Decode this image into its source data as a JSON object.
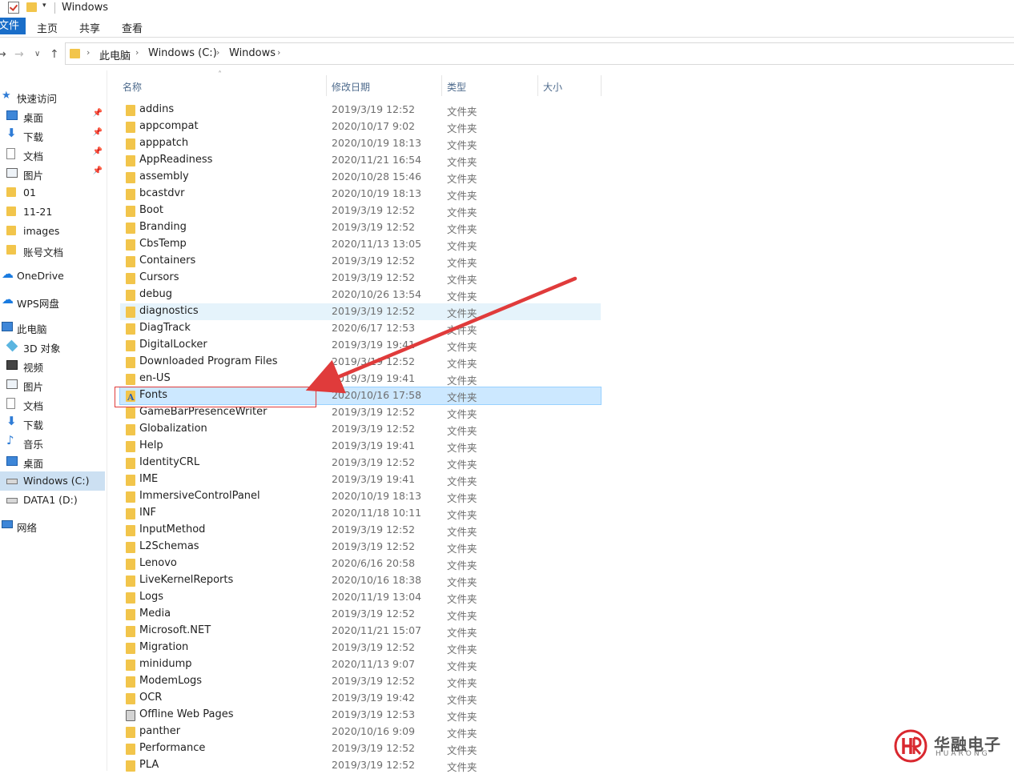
{
  "window": {
    "title": "Windows"
  },
  "ribbon": {
    "tabs": [
      "文件",
      "主页",
      "共享",
      "查看"
    ]
  },
  "address": {
    "crumbs": [
      "此电脑",
      "Windows (C:)",
      "Windows"
    ]
  },
  "columns": {
    "name": "名称",
    "date": "修改日期",
    "type": "类型",
    "size": "大小"
  },
  "sidebar": [
    {
      "label": "快速访问",
      "icon": "star-icon",
      "group": true
    },
    {
      "label": "桌面",
      "icon": "desktop-icon",
      "pinned": true
    },
    {
      "label": "下载",
      "icon": "download-icon",
      "pinned": true
    },
    {
      "label": "文档",
      "icon": "document-icon",
      "pinned": true
    },
    {
      "label": "图片",
      "icon": "picture-icon",
      "pinned": true
    },
    {
      "label": "01",
      "icon": "folder-icon"
    },
    {
      "label": "11-21",
      "icon": "folder-icon"
    },
    {
      "label": "images",
      "icon": "folder-icon"
    },
    {
      "label": "账号文档",
      "icon": "folder-icon"
    },
    {
      "label": "OneDrive",
      "icon": "cloud-icon",
      "group": true
    },
    {
      "label": "WPS网盘",
      "icon": "cloud-icon",
      "group": true
    },
    {
      "label": "此电脑",
      "icon": "pc-icon",
      "group": true
    },
    {
      "label": "3D 对象",
      "icon": "3d-objects-icon"
    },
    {
      "label": "视频",
      "icon": "video-icon"
    },
    {
      "label": "图片",
      "icon": "picture-icon"
    },
    {
      "label": "文档",
      "icon": "document-icon"
    },
    {
      "label": "下载",
      "icon": "download-icon"
    },
    {
      "label": "音乐",
      "icon": "music-icon"
    },
    {
      "label": "桌面",
      "icon": "desktop-icon"
    },
    {
      "label": "Windows (C:)",
      "icon": "drive-icon",
      "selected": true
    },
    {
      "label": "DATA1 (D:)",
      "icon": "drive-icon"
    },
    {
      "label": "网络",
      "icon": "network-icon",
      "group": true
    }
  ],
  "files": [
    {
      "name": "addins",
      "date": "2019/3/19 12:52",
      "type": "文件夹"
    },
    {
      "name": "appcompat",
      "date": "2020/10/17 9:02",
      "type": "文件夹"
    },
    {
      "name": "apppatch",
      "date": "2020/10/19 18:13",
      "type": "文件夹"
    },
    {
      "name": "AppReadiness",
      "date": "2020/11/21 16:54",
      "type": "文件夹"
    },
    {
      "name": "assembly",
      "date": "2020/10/28 15:46",
      "type": "文件夹"
    },
    {
      "name": "bcastdvr",
      "date": "2020/10/19 18:13",
      "type": "文件夹"
    },
    {
      "name": "Boot",
      "date": "2019/3/19 12:52",
      "type": "文件夹"
    },
    {
      "name": "Branding",
      "date": "2019/3/19 12:52",
      "type": "文件夹"
    },
    {
      "name": "CbsTemp",
      "date": "2020/11/13 13:05",
      "type": "文件夹"
    },
    {
      "name": "Containers",
      "date": "2019/3/19 12:52",
      "type": "文件夹"
    },
    {
      "name": "Cursors",
      "date": "2019/3/19 12:52",
      "type": "文件夹"
    },
    {
      "name": "debug",
      "date": "2020/10/26 13:54",
      "type": "文件夹"
    },
    {
      "name": "diagnostics",
      "date": "2019/3/19 12:52",
      "type": "文件夹",
      "state": "hover"
    },
    {
      "name": "DiagTrack",
      "date": "2020/6/17 12:53",
      "type": "文件夹"
    },
    {
      "name": "DigitalLocker",
      "date": "2019/3/19 19:41",
      "type": "文件夹"
    },
    {
      "name": "Downloaded Program Files",
      "date": "2019/3/19 12:52",
      "type": "文件夹"
    },
    {
      "name": "en-US",
      "date": "2019/3/19 19:41",
      "type": "文件夹"
    },
    {
      "name": "Fonts",
      "date": "2020/10/16 17:58",
      "type": "文件夹",
      "state": "selected",
      "icon": "fonts-folder-icon"
    },
    {
      "name": "GameBarPresenceWriter",
      "date": "2019/3/19 12:52",
      "type": "文件夹"
    },
    {
      "name": "Globalization",
      "date": "2019/3/19 12:52",
      "type": "文件夹"
    },
    {
      "name": "Help",
      "date": "2019/3/19 19:41",
      "type": "文件夹"
    },
    {
      "name": "IdentityCRL",
      "date": "2019/3/19 12:52",
      "type": "文件夹"
    },
    {
      "name": "IME",
      "date": "2019/3/19 19:41",
      "type": "文件夹"
    },
    {
      "name": "ImmersiveControlPanel",
      "date": "2020/10/19 18:13",
      "type": "文件夹"
    },
    {
      "name": "INF",
      "date": "2020/11/18 10:11",
      "type": "文件夹"
    },
    {
      "name": "InputMethod",
      "date": "2019/3/19 12:52",
      "type": "文件夹"
    },
    {
      "name": "L2Schemas",
      "date": "2019/3/19 12:52",
      "type": "文件夹"
    },
    {
      "name": "Lenovo",
      "date": "2020/6/16 20:58",
      "type": "文件夹"
    },
    {
      "name": "LiveKernelReports",
      "date": "2020/10/16 18:38",
      "type": "文件夹"
    },
    {
      "name": "Logs",
      "date": "2020/11/19 13:04",
      "type": "文件夹"
    },
    {
      "name": "Media",
      "date": "2019/3/19 12:52",
      "type": "文件夹"
    },
    {
      "name": "Microsoft.NET",
      "date": "2020/11/21 15:07",
      "type": "文件夹"
    },
    {
      "name": "Migration",
      "date": "2019/3/19 12:52",
      "type": "文件夹"
    },
    {
      "name": "minidump",
      "date": "2020/11/13 9:07",
      "type": "文件夹"
    },
    {
      "name": "ModemLogs",
      "date": "2019/3/19 12:52",
      "type": "文件夹"
    },
    {
      "name": "OCR",
      "date": "2019/3/19 19:42",
      "type": "文件夹"
    },
    {
      "name": "Offline Web Pages",
      "date": "2019/3/19 12:53",
      "type": "文件夹",
      "icon": "web-folder-icon"
    },
    {
      "name": "panther",
      "date": "2020/10/16 9:09",
      "type": "文件夹"
    },
    {
      "name": "Performance",
      "date": "2019/3/19 12:52",
      "type": "文件夹"
    },
    {
      "name": "PLA",
      "date": "2019/3/19 12:52",
      "type": "文件夹"
    }
  ],
  "colors": {
    "accent": "#1a6ec9",
    "selection": "#cce8ff",
    "hover": "#e5f3fb",
    "annotation": "#e03b3b",
    "folder": "#f2c54b"
  },
  "watermark": {
    "cn": "华融电子",
    "en": "HUARONG"
  }
}
